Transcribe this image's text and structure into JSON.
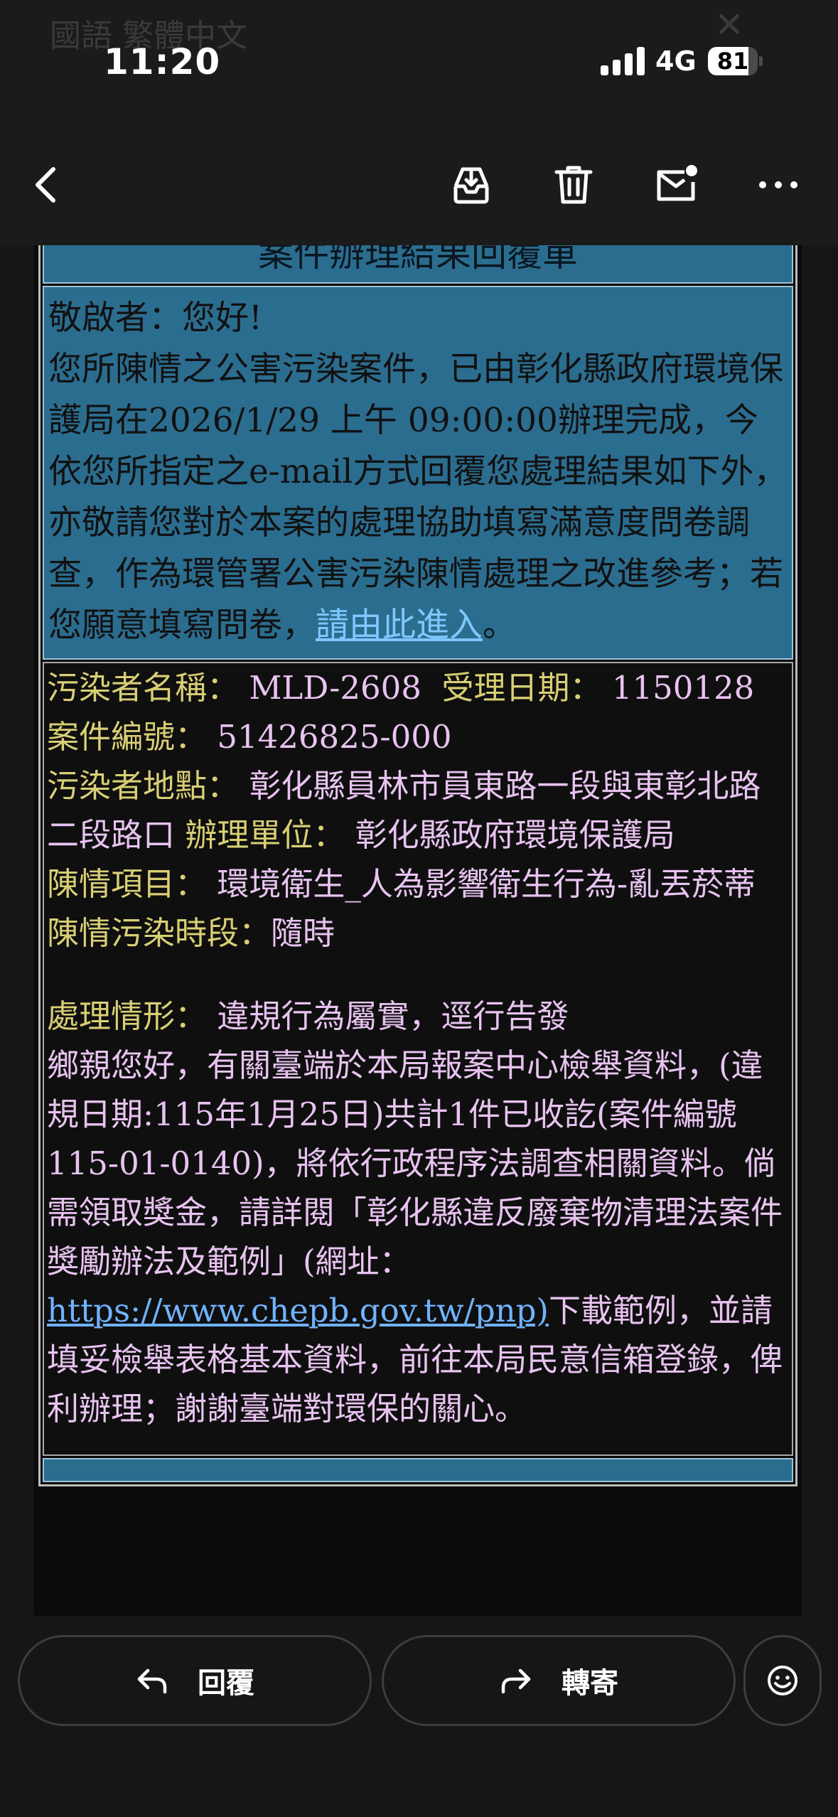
{
  "status_bar": {
    "time": "11:20",
    "network": "4G",
    "battery": "81",
    "battery_level": 0.81,
    "background_title": "國語 繁體中文"
  },
  "toolbar": {
    "icons": [
      "back-chevron-icon",
      "archive-icon",
      "trash-icon",
      "mark-unread-icon",
      "more-icon"
    ]
  },
  "email": {
    "title": "案件辦理結果回覆單",
    "greeting": "敬啟者：您好!",
    "intro": "您所陳情之公害污染案件，已由彰化縣政府環境保護局在2026/1/29 上午 09:00:00辦理完成，今依您所指定之e-mail方式回覆您處理結果如下外，亦敬請您對於本案的處理協助填寫滿意度問卷調查，作為環管署公害污染陳情處理之改進參考；若您願意填寫問卷，",
    "survey_link": "請由此進入",
    "intro_end": "。",
    "fields": {
      "polluter_name_label": "污染者名稱：",
      "polluter_name": "MLD-2608",
      "accept_date_label": "受理日期：",
      "accept_date": "1150128",
      "case_no_label": "案件編號：",
      "case_no": "51426825-000",
      "location_label": "污染者地點：",
      "location": "彰化縣員林市員東路一段與東彰北路二段路口",
      "unit_label": "辦理單位：",
      "unit": "彰化縣政府環境保護局",
      "item_label": "陳情項目：",
      "item": "環境衛生_人為影響衛生行為-亂丟菸蒂",
      "period_label": "陳情污染時段：",
      "period": "隨時",
      "status_label": "處理情形：",
      "status": "違規行為屬實，逕行告發"
    },
    "reply_part1": "鄉親您好，有關臺端於本局報案中心檢舉資料，(違規日期:115年1月25日)共計1件已收訖(案件編號115-01-0140)，將依行政程序法調查相關資料。倘需領取獎金，請詳閱「彰化縣違反廢棄物清理法案件獎勵辦法及範例」(網址：",
    "reply_link": "https://www.chepb.gov.tw/pnp)",
    "reply_part2": "下載範例，並請填妥檢舉表格基本資料，前往本局民意信箱登錄，俾利辦理；謝謝臺端對環保的關心。"
  },
  "bottom_bar": {
    "reply_label": "回覆",
    "forward_label": "轉寄"
  }
}
